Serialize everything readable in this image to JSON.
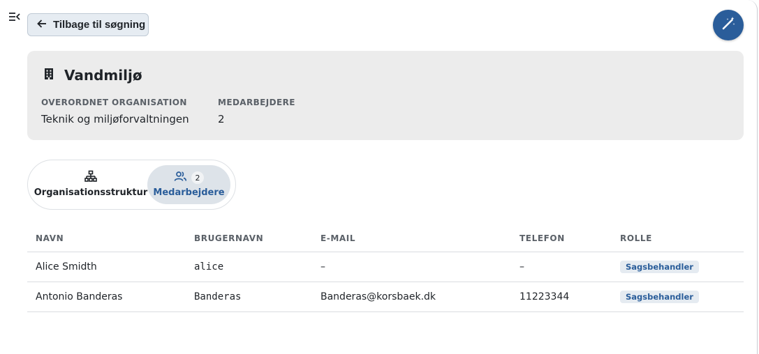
{
  "header": {
    "back_label": "Tilbage til søgning",
    "menu_icon": "collapse-menu-icon",
    "fab_icon": "magic-wand-icon"
  },
  "unit": {
    "name": "Vandmiljø",
    "icon": "building-icon",
    "parent_label": "OVERORDNET ORGANISATION",
    "parent_value": "Teknik og miljøforvaltningen",
    "employees_label": "MEDARBEJDERE",
    "employees_value": "2"
  },
  "tabs": [
    {
      "label": "Organisationsstruktur",
      "icon": "org-chart-icon",
      "active": false
    },
    {
      "label": "Medarbejdere",
      "icon": "people-icon",
      "count": "2",
      "active": true
    }
  ],
  "table": {
    "columns": [
      "NAVN",
      "BRUGERNAVN",
      "E-MAIL",
      "TELEFON",
      "ROLLE"
    ],
    "rows": [
      {
        "name": "Alice Smidth",
        "username": "alice",
        "email": "–",
        "phone": "–",
        "role": "Sagsbehandler"
      },
      {
        "name": "Antonio Banderas",
        "username": "Banderas",
        "email": "Banderas@korsbaek.dk",
        "phone": "11223344",
        "role": "Sagsbehandler"
      }
    ]
  },
  "colors": {
    "accent": "#2a5d9a",
    "card_bg": "#ececec",
    "active_tab_bg": "#dde3e9"
  }
}
